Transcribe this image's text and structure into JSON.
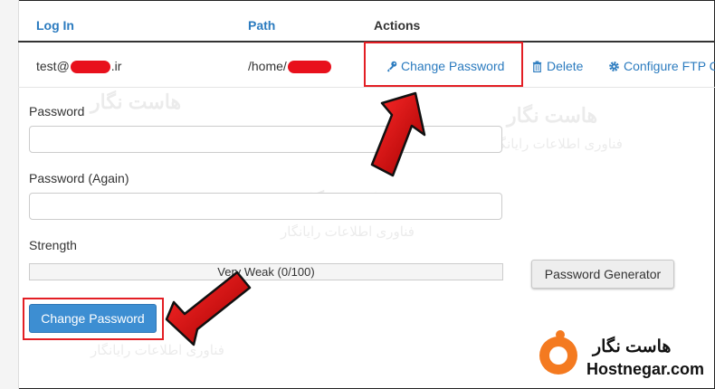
{
  "table": {
    "headers": {
      "login": "Log In",
      "path": "Path",
      "actions": "Actions"
    },
    "row": {
      "login_prefix": "test@",
      "login_suffix": ".ir",
      "path_prefix": "/home/",
      "actions": {
        "change_password": "Change Password",
        "delete": "Delete",
        "configure": "Configure FTP C"
      }
    }
  },
  "form": {
    "password_label": "Password",
    "password_again_label": "Password (Again)",
    "strength_label": "Strength",
    "strength_text": "Very Weak (0/100)",
    "strength_value": 0,
    "generator_button": "Password Generator",
    "submit_button": "Change Password"
  },
  "watermark": {
    "name_fa": "هاست نگار",
    "tagline_fa": "فناوری اطلاعات رایانگار"
  },
  "logo": {
    "name_fa": "هاست نگار",
    "name_en": "Hostnegar.com"
  },
  "colors": {
    "link": "#2b7bbf",
    "primary_button": "#3d8ed2",
    "highlight": "#e31e24",
    "brand": "#f47a20"
  },
  "icons": [
    "key-icon",
    "trash-icon",
    "gear-icon",
    "arrow-pointer-icon"
  ]
}
